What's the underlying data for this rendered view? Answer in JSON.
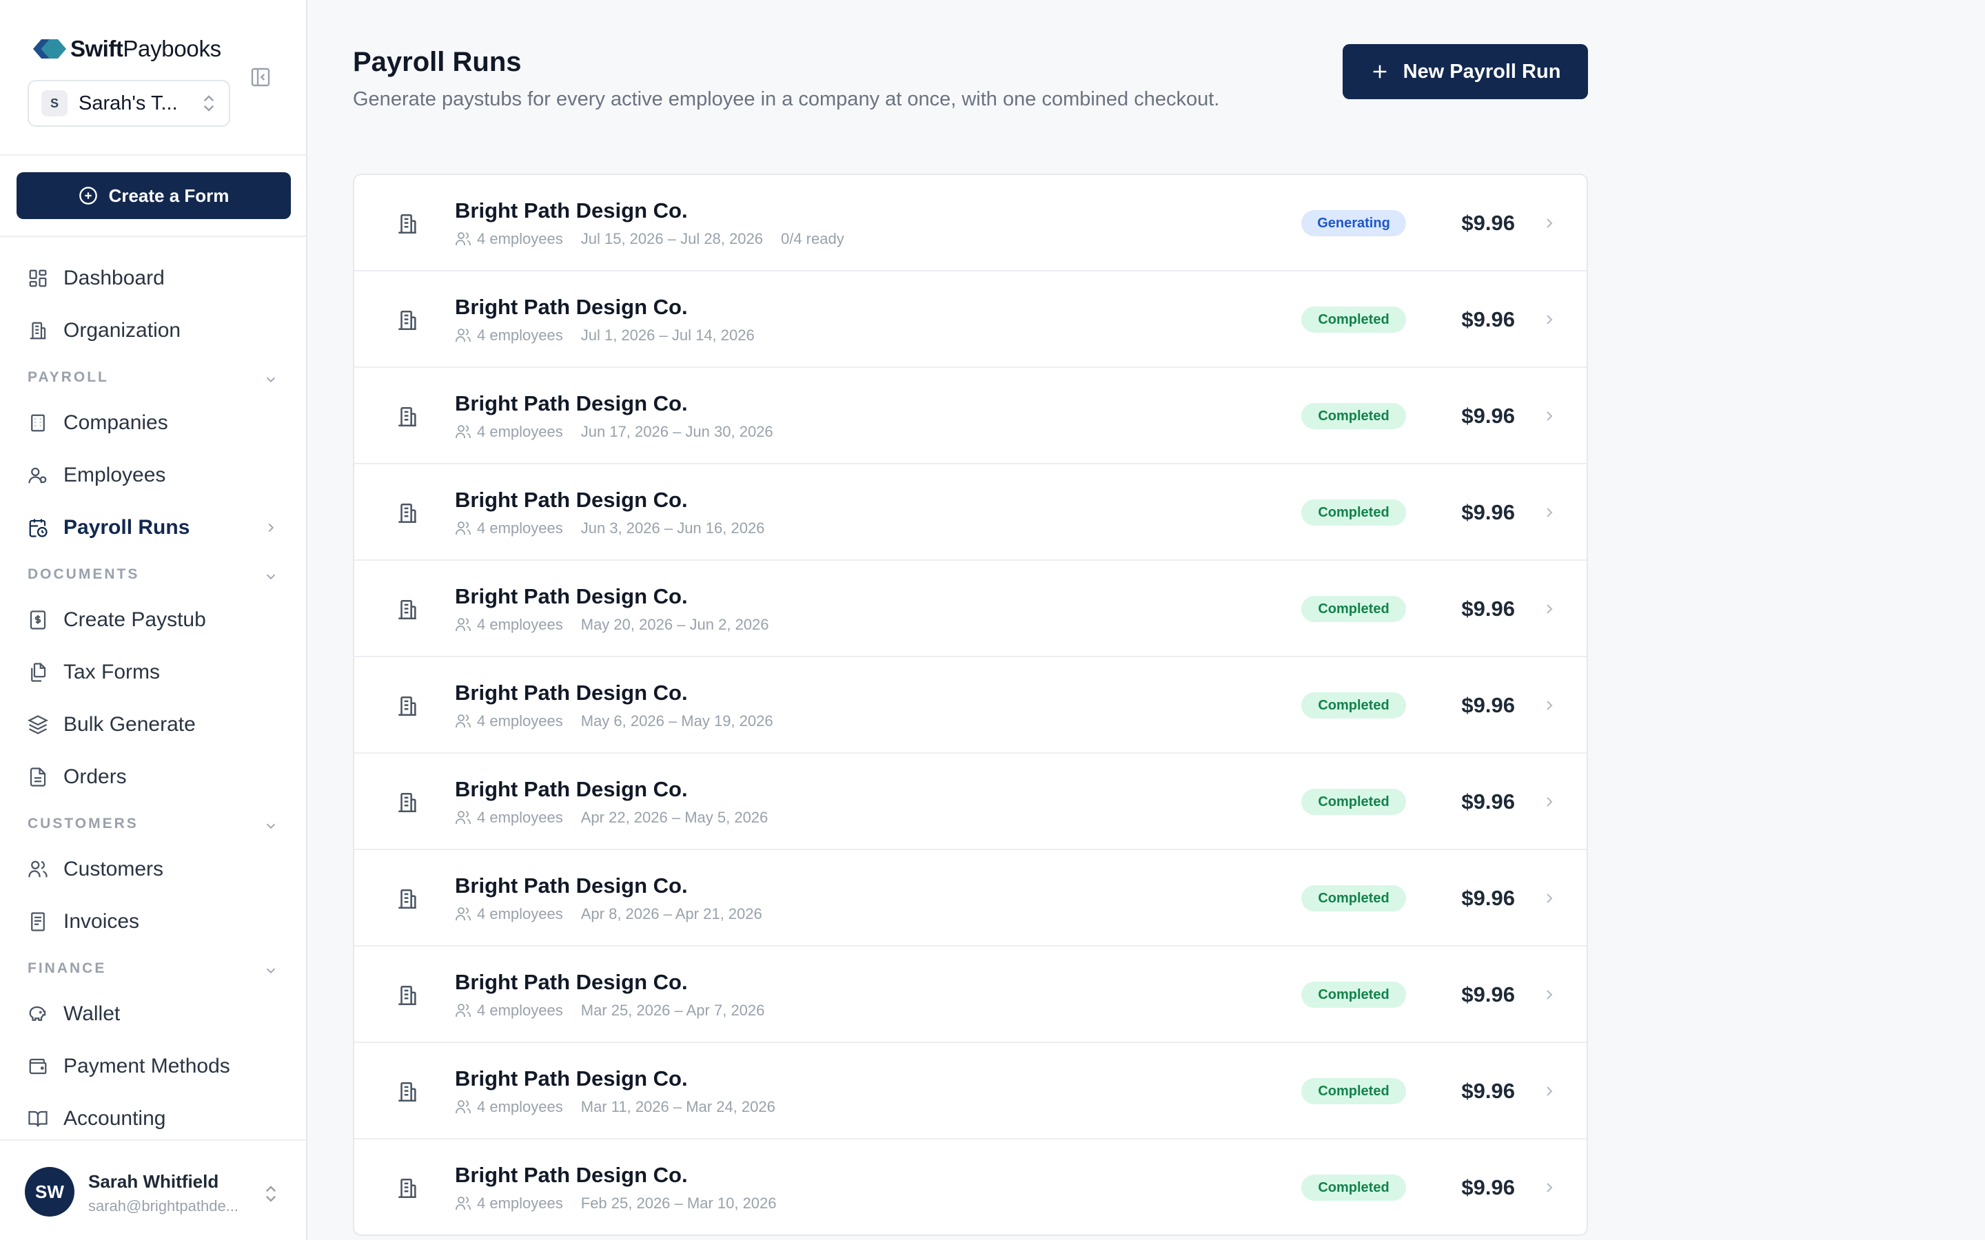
{
  "brand": {
    "name_bold": "Swift",
    "name_regular": "Paybooks",
    "accent": "#12284f"
  },
  "workspace": {
    "badge": "S",
    "name": "Sarah's T..."
  },
  "sidebar": {
    "create_label": "Create a Form",
    "items_top": [
      {
        "label": "Dashboard",
        "icon": "dashboard-icon"
      },
      {
        "label": "Organization",
        "icon": "building-icon"
      }
    ],
    "sections": [
      {
        "label": "PAYROLL",
        "items": [
          {
            "label": "Companies",
            "icon": "office-icon"
          },
          {
            "label": "Employees",
            "icon": "user-icon"
          },
          {
            "label": "Payroll Runs",
            "icon": "calendar-clock-icon",
            "active": true
          }
        ]
      },
      {
        "label": "DOCUMENTS",
        "items": [
          {
            "label": "Create Paystub",
            "icon": "dollar-doc-icon"
          },
          {
            "label": "Tax Forms",
            "icon": "copy-icon"
          },
          {
            "label": "Bulk Generate",
            "icon": "layers-icon"
          },
          {
            "label": "Orders",
            "icon": "file-icon"
          }
        ]
      },
      {
        "label": "CUSTOMERS",
        "items": [
          {
            "label": "Customers",
            "icon": "users-icon"
          },
          {
            "label": "Invoices",
            "icon": "receipt-icon"
          }
        ]
      },
      {
        "label": "FINANCE",
        "items": [
          {
            "label": "Wallet",
            "icon": "piggy-bank-icon"
          },
          {
            "label": "Payment Methods",
            "icon": "wallet-icon"
          },
          {
            "label": "Accounting",
            "icon": "book-icon"
          }
        ]
      }
    ]
  },
  "user": {
    "initials": "SW",
    "name": "Sarah Whitfield",
    "email": "sarah@brightpathde..."
  },
  "main": {
    "title": "Payroll Runs",
    "subtitle": "Generate paystubs for every active employee in a company at once, with one combined checkout.",
    "new_button": "New Payroll Run"
  },
  "runs": [
    {
      "company": "Bright Path Design Co.",
      "employees": "4 employees",
      "period": "Jul 15, 2026 – Jul 28, 2026",
      "ready": "0/4 ready",
      "status": "Generating",
      "amount": "$9.96"
    },
    {
      "company": "Bright Path Design Co.",
      "employees": "4 employees",
      "period": "Jul 1, 2026 – Jul 14, 2026",
      "ready": "",
      "status": "Completed",
      "amount": "$9.96"
    },
    {
      "company": "Bright Path Design Co.",
      "employees": "4 employees",
      "period": "Jun 17, 2026 – Jun 30, 2026",
      "ready": "",
      "status": "Completed",
      "amount": "$9.96"
    },
    {
      "company": "Bright Path Design Co.",
      "employees": "4 employees",
      "period": "Jun 3, 2026 – Jun 16, 2026",
      "ready": "",
      "status": "Completed",
      "amount": "$9.96"
    },
    {
      "company": "Bright Path Design Co.",
      "employees": "4 employees",
      "period": "May 20, 2026 – Jun 2, 2026",
      "ready": "",
      "status": "Completed",
      "amount": "$9.96"
    },
    {
      "company": "Bright Path Design Co.",
      "employees": "4 employees",
      "period": "May 6, 2026 – May 19, 2026",
      "ready": "",
      "status": "Completed",
      "amount": "$9.96"
    },
    {
      "company": "Bright Path Design Co.",
      "employees": "4 employees",
      "period": "Apr 22, 2026 – May 5, 2026",
      "ready": "",
      "status": "Completed",
      "amount": "$9.96"
    },
    {
      "company": "Bright Path Design Co.",
      "employees": "4 employees",
      "period": "Apr 8, 2026 – Apr 21, 2026",
      "ready": "",
      "status": "Completed",
      "amount": "$9.96"
    },
    {
      "company": "Bright Path Design Co.",
      "employees": "4 employees",
      "period": "Mar 25, 2026 – Apr 7, 2026",
      "ready": "",
      "status": "Completed",
      "amount": "$9.96"
    },
    {
      "company": "Bright Path Design Co.",
      "employees": "4 employees",
      "period": "Mar 11, 2026 – Mar 24, 2026",
      "ready": "",
      "status": "Completed",
      "amount": "$9.96"
    },
    {
      "company": "Bright Path Design Co.",
      "employees": "4 employees",
      "period": "Feb 25, 2026 – Mar 10, 2026",
      "ready": "",
      "status": "Completed",
      "amount": "$9.96"
    }
  ]
}
